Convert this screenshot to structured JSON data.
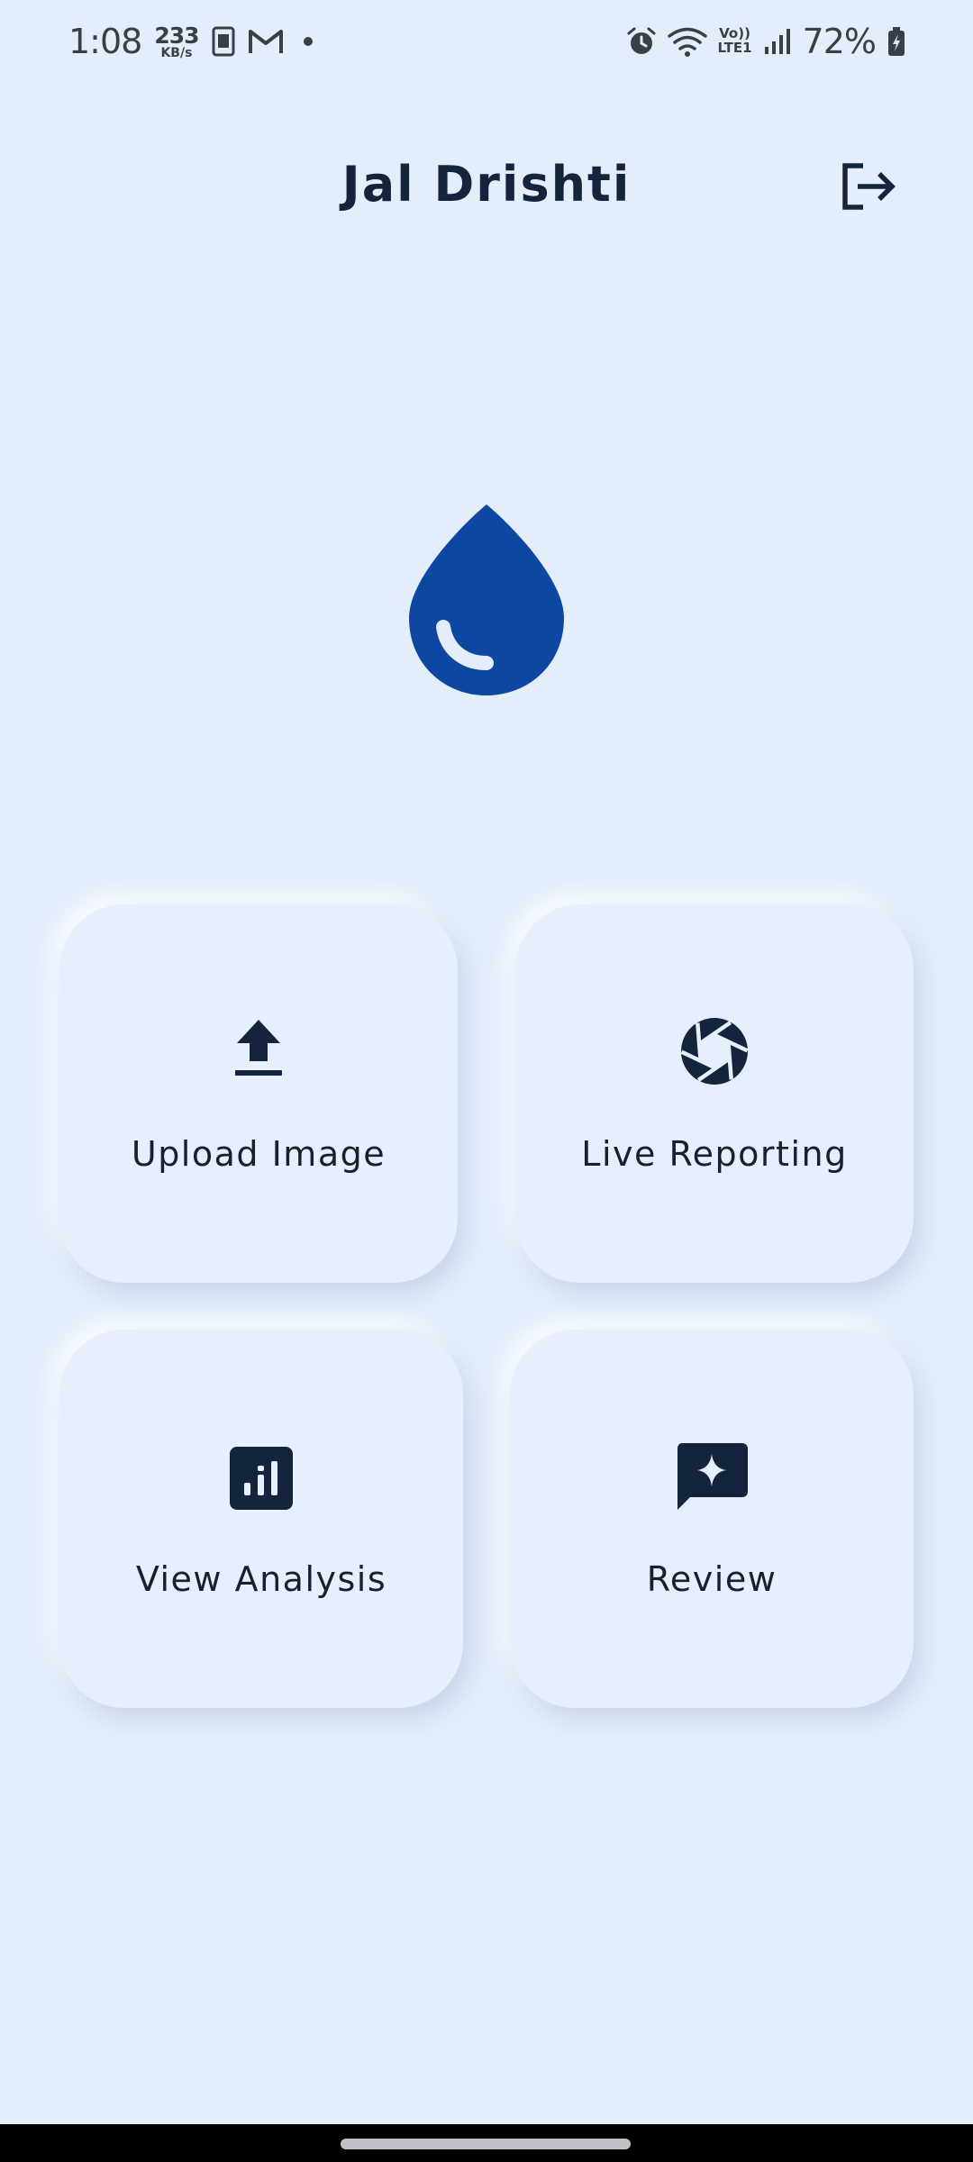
{
  "status_bar": {
    "time": "1:08",
    "speed_value": "233",
    "speed_unit": "KB/s",
    "network_top": "Vo))",
    "network_bottom": "LTE1",
    "battery": "72%"
  },
  "header": {
    "title": "Jal Drishti",
    "logout_icon": "logout-icon"
  },
  "logo": {
    "icon": "water-drop-icon",
    "color": "#0d47a1"
  },
  "actions": [
    {
      "label": "Upload Image",
      "icon": "upload-icon"
    },
    {
      "label": "Live Reporting",
      "icon": "camera-aperture-icon"
    },
    {
      "label": "View Analysis",
      "icon": "bar-chart-icon"
    },
    {
      "label": "Review",
      "icon": "review-chat-icon"
    }
  ],
  "colors": {
    "background": "#e4eefb",
    "primary": "#0d47a1",
    "text": "#13243c"
  }
}
